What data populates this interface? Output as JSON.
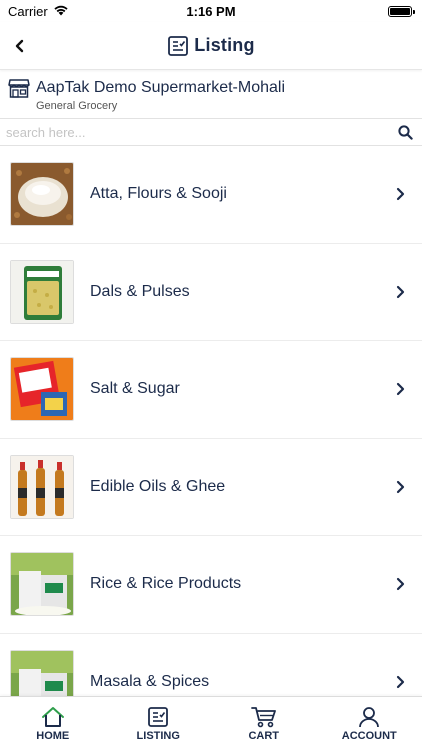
{
  "status_bar": {
    "carrier": "Carrier",
    "time": "1:16 PM"
  },
  "nav": {
    "title": "Listing"
  },
  "store": {
    "name": "AapTak Demo Supermarket-Mohali",
    "category": "General Grocery"
  },
  "search": {
    "placeholder": "search here..."
  },
  "categories": [
    {
      "label": "Atta, Flours & Sooji"
    },
    {
      "label": "Dals & Pulses"
    },
    {
      "label": "Salt & Sugar"
    },
    {
      "label": "Edible Oils & Ghee"
    },
    {
      "label": "Rice & Rice Products"
    },
    {
      "label": "Masala & Spices"
    }
  ],
  "tabs": [
    {
      "label": "HOME",
      "icon": "home-icon"
    },
    {
      "label": "LISTING",
      "icon": "listing-icon"
    },
    {
      "label": "CART",
      "icon": "cart-icon"
    },
    {
      "label": "ACCOUNT",
      "icon": "account-icon"
    }
  ],
  "colors": {
    "primary": "#1c2b4a",
    "home_accent": "#2e9e4b"
  }
}
